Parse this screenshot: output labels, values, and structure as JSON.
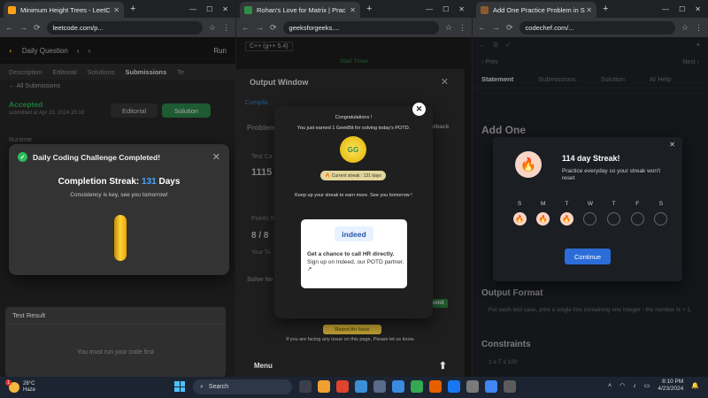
{
  "windows": {
    "leetcode": {
      "tab_title": "Minimum Height Trees - LeetC",
      "url": "leetcode.com/p...",
      "topbar": {
        "daily": "Daily Question",
        "run": "Run"
      },
      "tabs": [
        "Description",
        "Editorial",
        "Solutions",
        "Submissions",
        "Te"
      ],
      "all_submissions": "All Submissions",
      "status": "Accepted",
      "submitted": "submitted at Apr 23, 2024 20:18",
      "editorial_btn": "Editorial",
      "solution_btn": "Solution",
      "runtime_label": "Runtime",
      "modal": {
        "title": "Daily Coding Challenge Completed!",
        "streak_label": "Completion Streak:",
        "streak_value": "131",
        "streak_unit": "Days",
        "message": "Consistency is key, see you tomorrow!"
      },
      "test_result": {
        "title": "Test Result",
        "empty": "You must run your code first"
      }
    },
    "gfg": {
      "tab_title": "Rohan's Love for Matrix | Prac",
      "url": "geeksforgeeks....",
      "language": "C++ (g++ 5.4)",
      "start_timer": "Start Timer",
      "output_window": "Output Window",
      "ghost": {
        "compilation": "Compila",
        "problem": "Problem",
        "feedback": "edback",
        "testcase": "Test Ca",
        "value": "1115",
        "points": "Points S",
        "score": "8 / 8",
        "your_total": "Your To",
        "solve_next": "Solve Ne",
        "submit": "omit"
      },
      "modal": {
        "congrats": "Congratulations !",
        "earned": "You just earned 1 GeekBit for solving today's POTD.",
        "current_streak": "Current streak : 131 days",
        "keepup": "Keep up your streak to earn more. See you tomorrow !",
        "indeed_logo": "indeed",
        "indeed_bold": "Get a chance to call HR directly.",
        "indeed_rest": " Sign up on Indeed, our POTD partner."
      },
      "report": "Report An Issue",
      "facing": "If you are facing any issue on this page, Please let us know.",
      "menu": "Menu"
    },
    "codechef": {
      "tab_title": "Add One Practice Problem in S",
      "url": "codechef.com/...",
      "nav": {
        "prev": "Prev",
        "next": "Next"
      },
      "tabs": [
        "Statement",
        "Submissions",
        "Solution",
        "AI Help"
      ],
      "heading": "Add One",
      "output_format": "Output Format",
      "output_desc": "For each test case, print a single line containing one integer - the number N + 1.",
      "constraints": "Constraints",
      "constraint1": "1 ≤ T ≤ 100",
      "modal": {
        "title": "114 day Streak!",
        "subtitle": "Practice everyday so your streak won't reset",
        "days": [
          {
            "label": "S",
            "done": true
          },
          {
            "label": "M",
            "done": true
          },
          {
            "label": "T",
            "done": true
          },
          {
            "label": "W",
            "done": false
          },
          {
            "label": "T",
            "done": false
          },
          {
            "label": "F",
            "done": false
          },
          {
            "label": "S",
            "done": false
          }
        ],
        "button": "Continue"
      }
    }
  },
  "taskbar": {
    "weather_temp": "28°C",
    "weather_desc": "Haze",
    "notif_count": "1",
    "search": "Search",
    "time": "8:10 PM",
    "date": "4/23/2024"
  },
  "colors": {
    "leetcode_green": "#2cbb5d",
    "streak_blue": "#4aa3ff",
    "gfg_green": "#2f8d46",
    "codechef_blue": "#2b6cd9",
    "flame": "#f06a26"
  }
}
